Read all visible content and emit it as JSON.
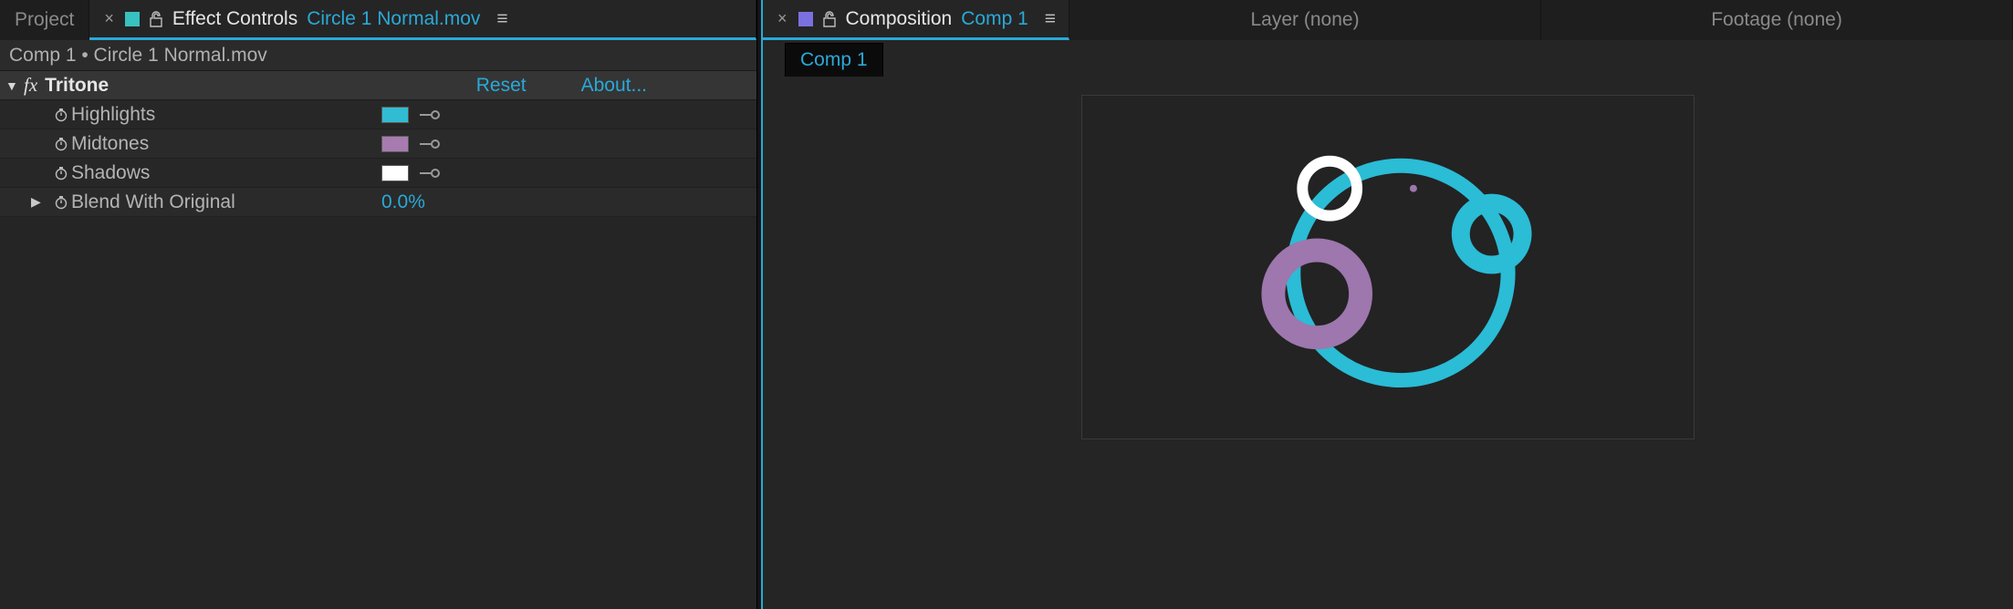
{
  "left": {
    "tabs": {
      "project": "Project",
      "effect_prefix": "Effect Controls",
      "effect_file": "Circle 1 Normal.mov"
    },
    "breadcrumb": "Comp 1 • Circle 1 Normal.mov",
    "effect": {
      "name": "Tritone",
      "reset": "Reset",
      "about": "About..."
    },
    "props": {
      "highlights": {
        "label": "Highlights",
        "color": "#31bcd3"
      },
      "midtones": {
        "label": "Midtones",
        "color": "#a77bb0"
      },
      "shadows": {
        "label": "Shadows",
        "color": "#ffffff"
      },
      "blend": {
        "label": "Blend With Original",
        "value": "0.0%"
      }
    }
  },
  "right": {
    "tabs": {
      "comp_prefix": "Composition",
      "comp_name": "Comp 1",
      "layer": "Layer (none)",
      "footage": "Footage (none)"
    },
    "comp_chip": "Comp 1",
    "colors": {
      "cyan": "#2bbcd6",
      "purple": "#9d77ad",
      "white": "#ffffff",
      "bg": "#232323"
    }
  }
}
